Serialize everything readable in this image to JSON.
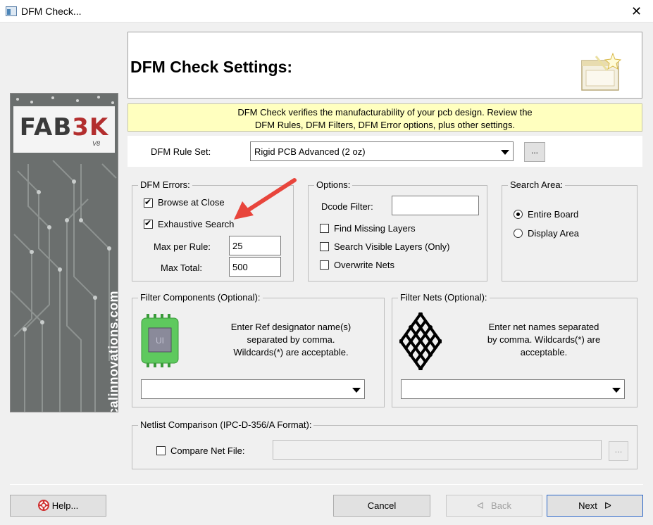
{
  "window": {
    "title": "DFM Check...",
    "close_glyph": "✕"
  },
  "banner": {
    "logo": "FAB3K",
    "logo_prefix": "FAB",
    "logo_accent": "3K",
    "version": "V8",
    "url": "numericalinnovations.com"
  },
  "header": {
    "title": "DFM Check Settings:",
    "icon": "wizard-window-icon"
  },
  "info": {
    "line1": "DFM Check verifies the manufacturability of your pcb design.  Review the",
    "line2": "DFM Rules, DFM Filters, DFM Error options, plus other settings."
  },
  "ruleset": {
    "label": "DFM Rule Set:",
    "value": "Rigid PCB Advanced (2 oz)",
    "more_label": "..."
  },
  "dfm_errors": {
    "label": "DFM Errors:",
    "browse_at_close": {
      "label": "Browse at Close",
      "checked": true
    },
    "exhaustive_search": {
      "label": "Exhaustive Search",
      "checked": true
    },
    "max_per_rule": {
      "label": "Max per Rule:",
      "value": "25"
    },
    "max_total": {
      "label": "Max Total:",
      "value": "500"
    }
  },
  "options": {
    "label": "Options:",
    "dcode_filter": {
      "label": "Dcode Filter:",
      "value": ""
    },
    "find_missing_layers": {
      "label": "Find Missing Layers",
      "checked": false
    },
    "search_visible_layers": {
      "label": "Search Visible Layers (Only)",
      "checked": false
    },
    "overwrite_nets": {
      "label": "Overwrite Nets",
      "checked": false
    }
  },
  "search_area": {
    "label": "Search Area:",
    "entire_board": {
      "label": "Entire Board",
      "selected": true
    },
    "display_area": {
      "label": "Display Area",
      "selected": false
    }
  },
  "filter_components": {
    "label": "Filter Components (Optional):",
    "chip_text": "UI",
    "desc1": "Enter Ref designator name(s)",
    "desc2": "separated by comma.",
    "desc3": "Wildcards(*) are acceptable.",
    "value": ""
  },
  "filter_nets": {
    "label": "Filter Nets (Optional):",
    "desc1": "Enter net names separated",
    "desc2": "by comma. Wildcards(*) are",
    "desc3": "acceptable.",
    "value": ""
  },
  "netlist": {
    "label": "Netlist Comparison (IPC-D-356/A Format):",
    "compare": {
      "label": "Compare Net File:",
      "checked": false
    },
    "value": "",
    "more_label": "..."
  },
  "buttons": {
    "help": "Help...",
    "cancel": "Cancel",
    "back": "Back",
    "next": "Next"
  },
  "colors": {
    "info_bg": "#ffffbf",
    "annotation_arrow": "#e8453c",
    "chip_green": "#5ec95e",
    "logo_accent": "#b32e2e"
  }
}
